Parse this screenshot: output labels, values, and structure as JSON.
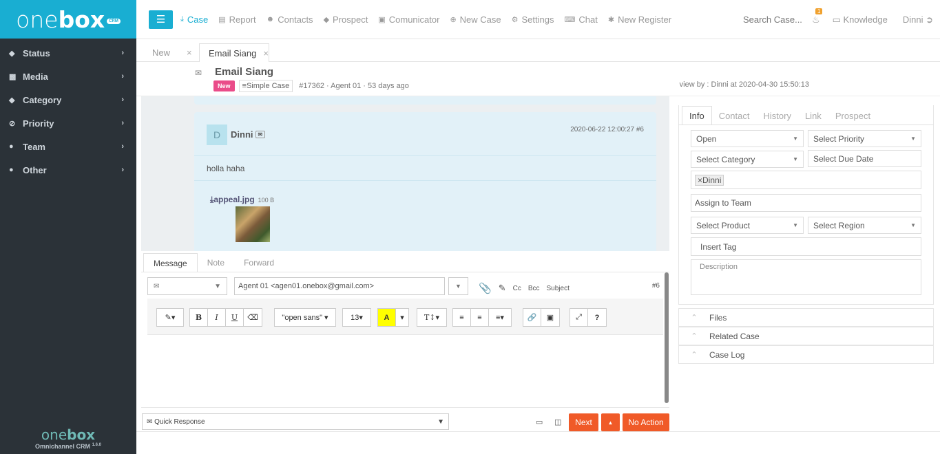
{
  "brand": {
    "one": "one",
    "box": "box",
    "crm": "CRM",
    "footer_one": "one",
    "footer_box": "box",
    "footer_caption": "Omnichannel CRM",
    "version": "1.6.0"
  },
  "sidebar": {
    "items": [
      {
        "label": "Status",
        "icon": "tag-icon"
      },
      {
        "label": "Media",
        "icon": "film-icon"
      },
      {
        "label": "Category",
        "icon": "tag-icon"
      },
      {
        "label": "Priority",
        "icon": "clock-icon"
      },
      {
        "label": "Team",
        "icon": "users-icon"
      },
      {
        "label": "Other",
        "icon": "users-icon"
      }
    ]
  },
  "nav": {
    "items": [
      {
        "label": "Case",
        "active": true
      },
      {
        "label": "Report"
      },
      {
        "label": "Contacts"
      },
      {
        "label": "Prospect"
      },
      {
        "label": "Comunicator"
      },
      {
        "label": "New Case"
      },
      {
        "label": "Settings"
      },
      {
        "label": "Chat"
      },
      {
        "label": "New Register"
      }
    ],
    "search": "Search Case...",
    "notif_count": "1",
    "knowledge": "Knowledge",
    "user": "Dinni"
  },
  "tabs": [
    {
      "label": "New"
    },
    {
      "label": "Email Siang",
      "active": true
    }
  ],
  "case": {
    "title": "Email Siang",
    "status": "New",
    "type": "Simple Case",
    "meta": "#17362  ·  Agent 01  ·  53 days ago",
    "viewby": "view by : Dinni at 2020-04-30 15:50:13"
  },
  "message": {
    "avatar": "D",
    "sender": "Dinni",
    "timestamp": "2020-06-22 12:00:27 #6",
    "body": "holla haha",
    "attachment_name": "appeal.jpg",
    "attachment_size": "100 B"
  },
  "editor": {
    "tabs": [
      "Message",
      "Note",
      "Forward"
    ],
    "from": "Agent 01 <agen01.onebox@gmail.com>",
    "cc": "Cc",
    "bcc": "Bcc",
    "subject": "Subject",
    "hash": "#6",
    "font": "\"open sans\"",
    "font_size": "13",
    "quick_response": "Quick Response"
  },
  "buttons": {
    "next": "Next",
    "no_action": "No Action"
  },
  "right": {
    "tabs": [
      "Info",
      "Contact",
      "History",
      "Link",
      "Prospect"
    ],
    "status": "Open",
    "priority": "Select Priority",
    "category": "Select Category",
    "due_date": "Select Due Date",
    "assignee": "Dinni",
    "team": "Assign to Team",
    "product": "Select Product",
    "region": "Select Region",
    "tag": "Insert Tag",
    "description": "Description",
    "sections": [
      "Files",
      "Related Case",
      "Case Log"
    ]
  },
  "colors": {
    "brand": "#19aed2",
    "sidebar": "#2b3238",
    "accent": "#f05a28",
    "tag_new": "#ea4c89"
  }
}
